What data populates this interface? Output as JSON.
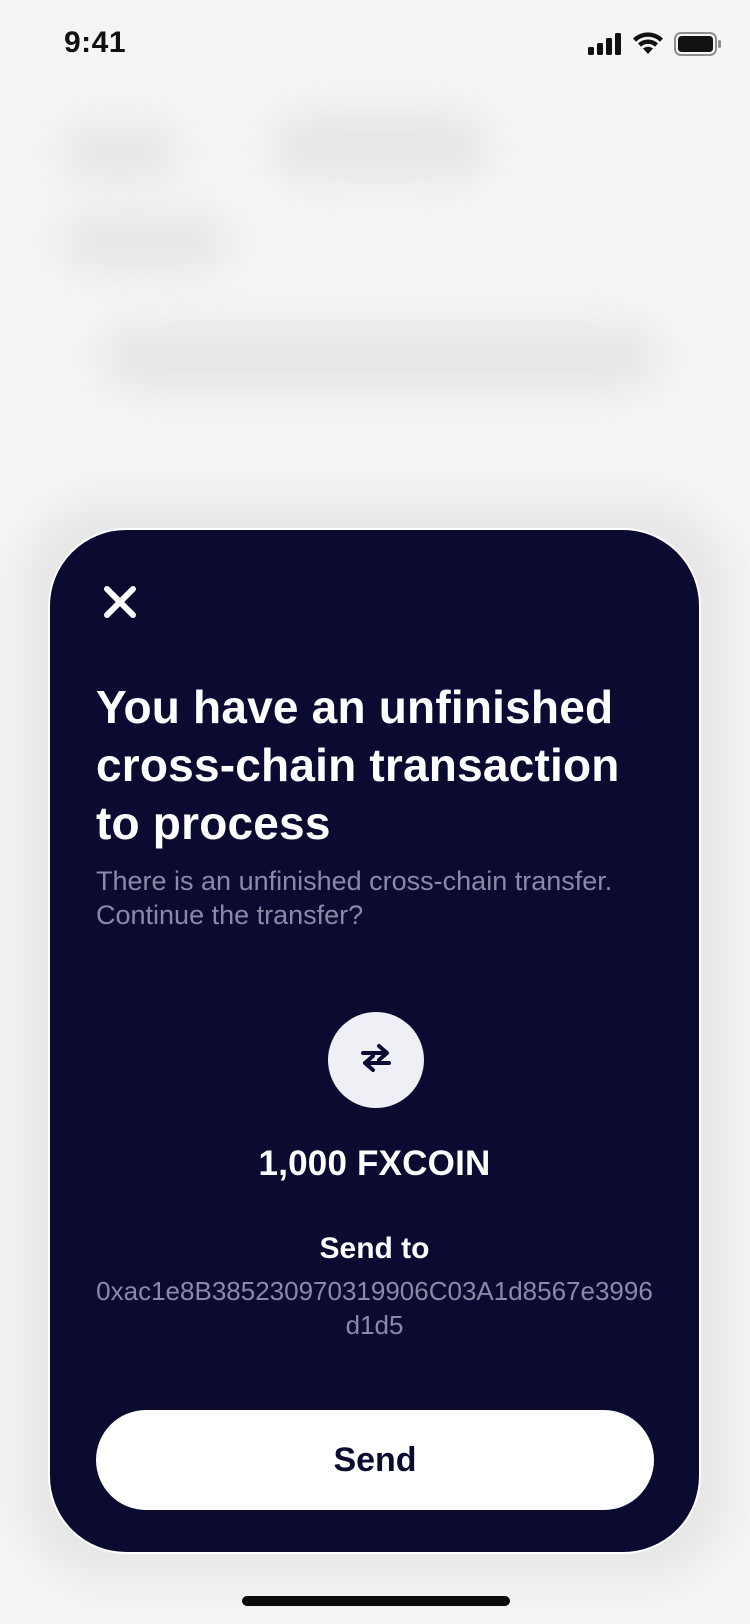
{
  "status_bar": {
    "time": "9:41",
    "icons": [
      "signal-icon",
      "wifi-icon",
      "battery-icon"
    ]
  },
  "modal": {
    "close_icon": "close-icon",
    "title": "You have an unfinished cross-chain transaction to process",
    "subtitle": "There is an unfinished cross-chain transfer. Continue the transfer?",
    "swap_icon": "swap-arrows-icon",
    "amount": "1,000 FXCOIN",
    "send_to_label": "Send to",
    "address": "0xac1e8B385230970319906C03A1d8567e3996d1d5",
    "send_button_label": "Send"
  },
  "colors": {
    "modal_background": "#0b0b32",
    "muted_text": "#8a8aa6",
    "page_background": "#f5f5f6",
    "button_background": "#ffffff"
  }
}
